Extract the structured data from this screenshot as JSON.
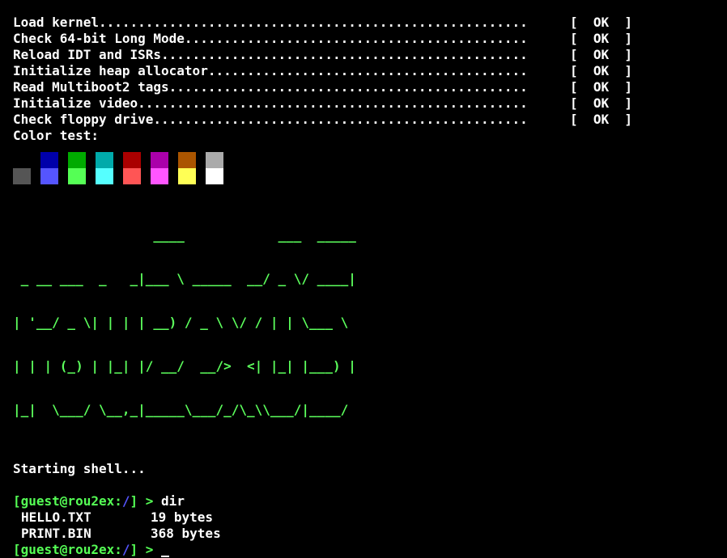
{
  "boot_checks": [
    {
      "label": "Load kernel.......................................................",
      "status": "[  OK  ]"
    },
    {
      "label": "Check 64-bit Long Mode............................................",
      "status": "[  OK  ]"
    },
    {
      "label": "Reload IDT and ISRs...............................................",
      "status": "[  OK  ]"
    },
    {
      "label": "Initialize heap allocator.........................................",
      "status": "[  OK  ]"
    },
    {
      "label": "Read Multiboot2 tags..............................................",
      "status": "[  OK  ]"
    },
    {
      "label": "Initialize video..................................................",
      "status": "[  OK  ]"
    },
    {
      "label": "Check floppy drive................................................",
      "status": "[  OK  ]"
    }
  ],
  "color_test": {
    "label": "Color test:",
    "top_row": [
      "#000000",
      "#0000aa",
      "#00aa00",
      "#00aaaa",
      "#aa0000",
      "#aa00aa",
      "#aa5500",
      "#aaaaaa"
    ],
    "bottom_row": [
      "#555555",
      "#5555ff",
      "#55ff55",
      "#55ffff",
      "#ff5555",
      "#ff55ff",
      "#ffff55",
      "#ffffff"
    ]
  },
  "logo_lines": [
    "                  ____            ___  _____",
    " _ __ ___  _   _|___ \\ _____  __/ _ \\/ ____|",
    "| '__/ _ \\| | | | __) / _ \\ \\/ / | | \\___ \\",
    "| | | (_) | |_| |/ __/  __/>  <| |_| |___) |",
    "|_|  \\___/ \\__,_|_____\\___/_/\\_\\\\___/|____/"
  ],
  "shell": {
    "starting": "Starting shell...",
    "prompt_user": "[guest@rou2ex:",
    "prompt_path": "/",
    "prompt_end": "] >",
    "command": "dir",
    "files": [
      {
        "name": "HELLO.TXT",
        "size": "19 bytes"
      },
      {
        "name": "PRINT.BIN",
        "size": "368 bytes"
      }
    ]
  },
  "colors": {
    "text": "#ffffff",
    "prompt_green": "#55ff55",
    "path_blue": "#5555ff",
    "logo_green": "#5cff5c",
    "background": "#000000"
  }
}
